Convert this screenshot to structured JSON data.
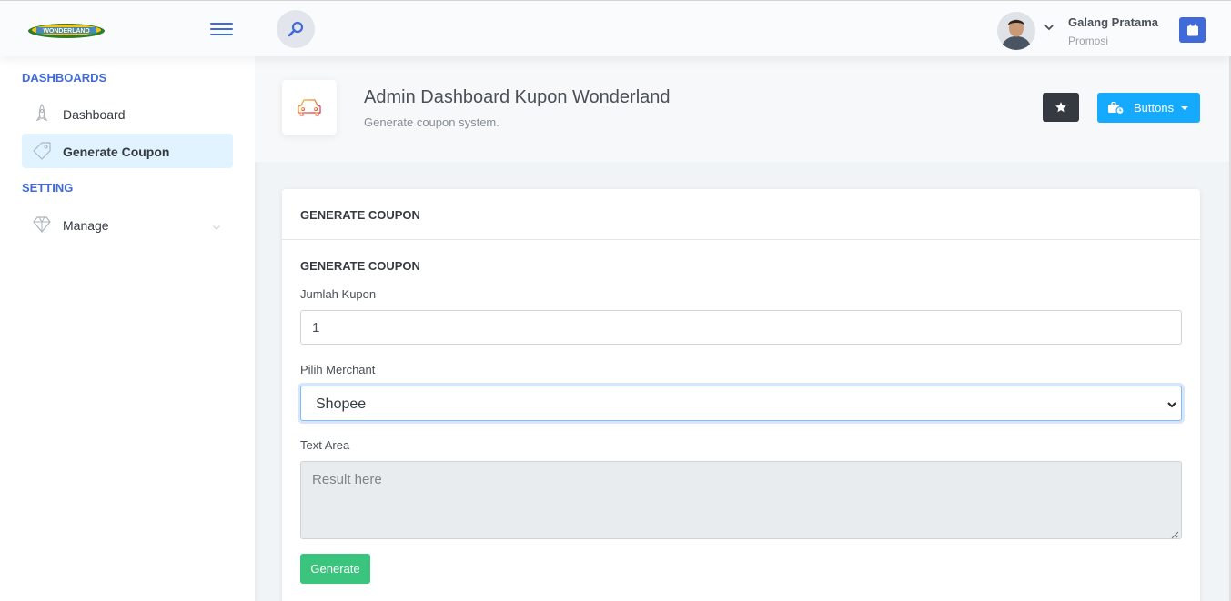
{
  "header": {
    "logo_text": "WONDERLAND",
    "user_name": "Galang Pratama",
    "user_role": "Promosi"
  },
  "sidebar": {
    "sections": [
      {
        "heading": "DASHBOARDS",
        "items": [
          {
            "label": "Dashboard",
            "icon": "rocket-icon",
            "active": false
          },
          {
            "label": "Generate Coupon",
            "icon": "tag-icon",
            "active": true
          }
        ]
      },
      {
        "heading": "SETTING",
        "items": [
          {
            "label": "Manage",
            "icon": "diamond-icon",
            "active": false,
            "has_submenu": true
          }
        ]
      }
    ]
  },
  "page": {
    "title": "Admin Dashboard Kupon Wonderland",
    "subtitle": "Generate coupon system.",
    "title_icon": "car-icon",
    "buttons_label": "Buttons"
  },
  "card": {
    "header_title": "GENERATE COUPON",
    "sub_title": "GENERATE COUPON",
    "jumlah_label": "Jumlah Kupon",
    "jumlah_value": "1",
    "merchant_label": "Pilih Merchant",
    "merchant_value": "Shopee",
    "textarea_label": "Text Area",
    "textarea_placeholder": "Result here",
    "generate_label": "Generate"
  },
  "colors": {
    "primary": "#3f6ad8",
    "info": "#16aaff",
    "success": "#3ac47d",
    "dark": "#343a40",
    "active_bg": "#e0f3ff"
  }
}
